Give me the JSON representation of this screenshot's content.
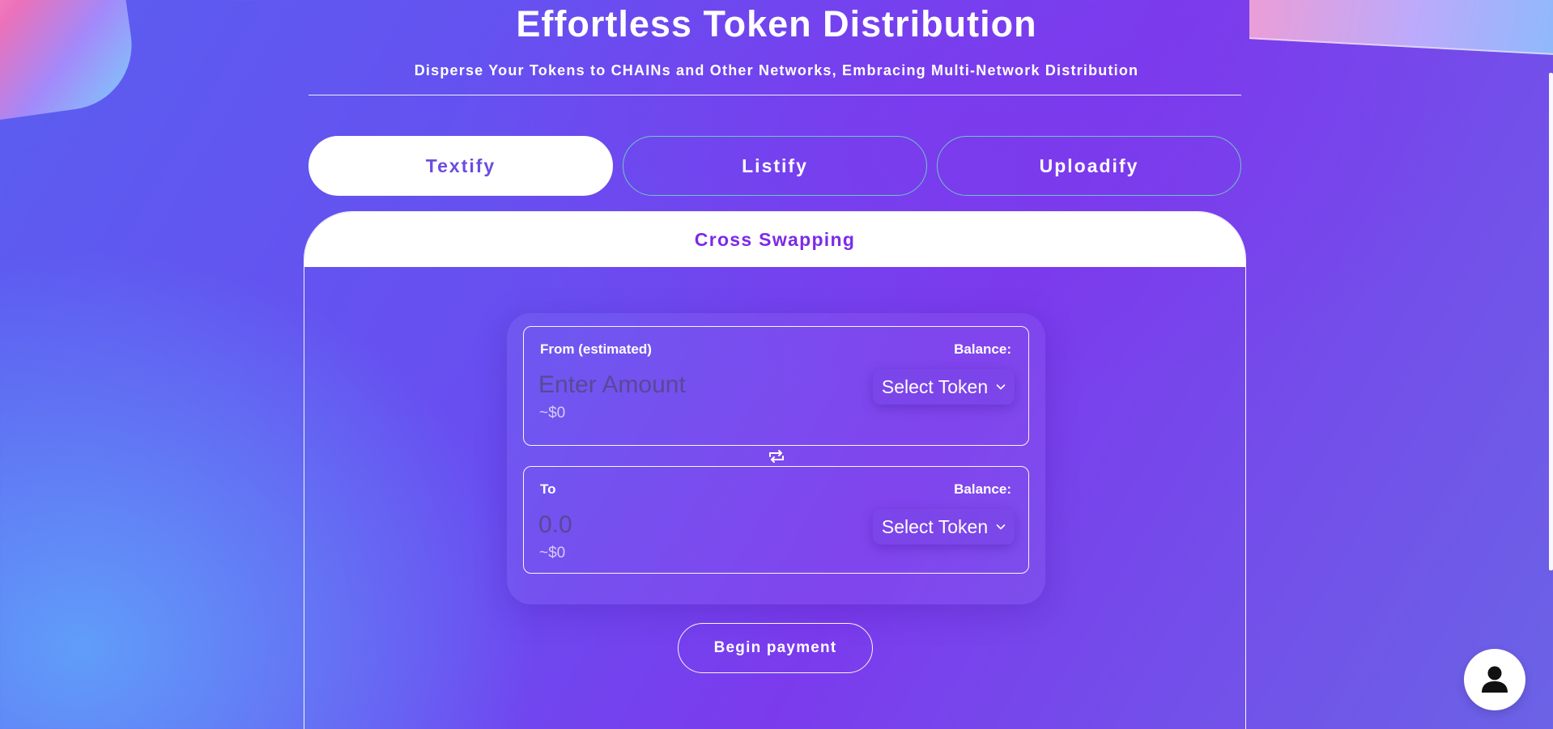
{
  "header": {
    "title": "Effortless Token Distribution",
    "subtitle": "Disperse Your Tokens to CHAINs and Other Networks, Embracing Multi-Network Distribution"
  },
  "tabs": [
    {
      "label": "Textify",
      "active": true
    },
    {
      "label": "Listify",
      "active": false
    },
    {
      "label": "Uploadify",
      "active": false
    }
  ],
  "card": {
    "title": "Cross Swapping"
  },
  "swap": {
    "from": {
      "label": "From (estimated)",
      "balance_label": "Balance:",
      "placeholder": "Enter Amount",
      "usd": "~$0",
      "token_label": "Select Token"
    },
    "to": {
      "label": "To",
      "balance_label": "Balance:",
      "placeholder": "0.0",
      "usd": "~$0",
      "token_label": "Select Token"
    },
    "swap_icon": "swap-arrows-icon"
  },
  "actions": {
    "pay_label": "Begin payment"
  },
  "icons": {
    "user": "user-icon",
    "chevron": "chevron-down-icon"
  },
  "colors": {
    "accent": "#7c2ae8",
    "tab_active_text": "#6d4ce0",
    "tab_border": "#6ee7b7"
  }
}
